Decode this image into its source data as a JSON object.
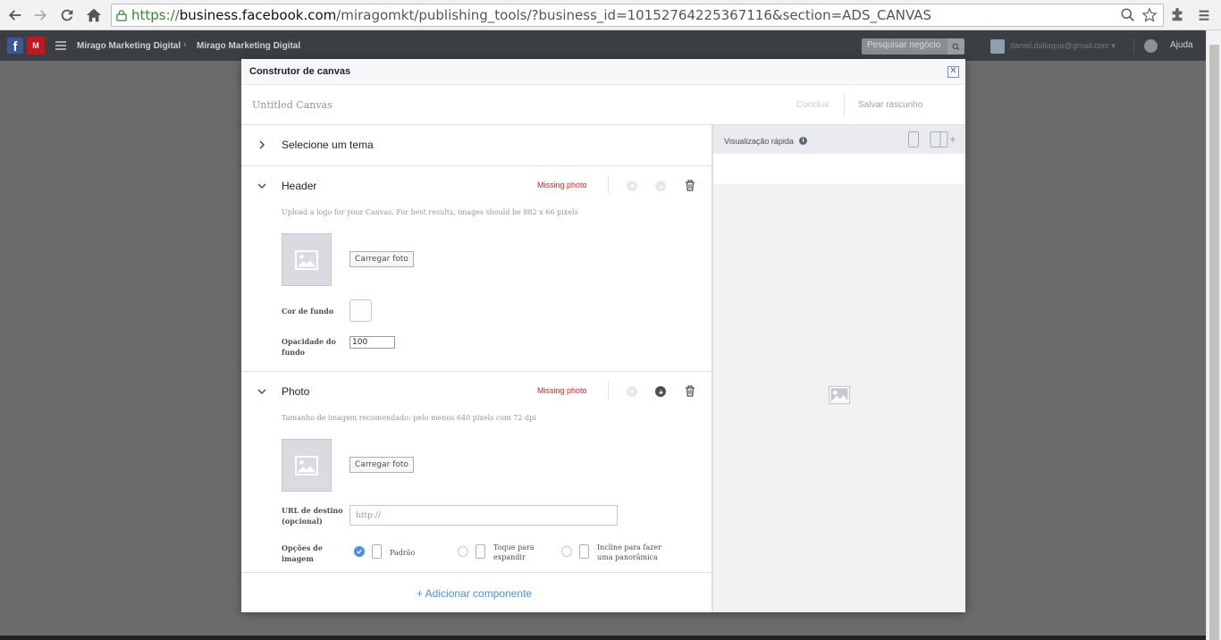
{
  "browser": {
    "url_scheme": "https://",
    "url_host": "business.facebook.com",
    "url_path": "/miragomkt/publishing_tools/?business_id=10152764225367116&section=ADS_CANVAS"
  },
  "fbbar": {
    "brand_logo_text": "M",
    "breadcrumb_1": "Mirago Marketing Digital",
    "breadcrumb_2": "Mirago Marketing Digital",
    "search_placeholder": "Pesquisar negócio",
    "user_email": "daniel.dallaqua@gmail.com ▾",
    "help_label": "Ajuda"
  },
  "modal": {
    "title": "Construtor de canvas",
    "canvas_name": "Untitled Canvas",
    "done_label": "Concluir",
    "save_draft_label": "Salvar rascunho"
  },
  "theme_section": {
    "label": "Selecione um tema"
  },
  "header_section": {
    "label": "Header",
    "status": "Missing photo",
    "hint": "Upload a logo for your Canvas. For best results, images should be 882 x 66 pixels",
    "upload_label": "Carregar foto",
    "bg_color_label": "Cor de fundo",
    "opacity_label_1": "Opacidade do",
    "opacity_label_2": "fundo",
    "opacity_value": "100"
  },
  "photo_section": {
    "label": "Photo",
    "status": "Missing photo",
    "hint": "Tamanho de imagem recomendado: pelo menos 640 pixels com 72 dpi",
    "upload_label": "Carregar foto",
    "url_label_1": "URL de destino",
    "url_label_2": "(opcional)",
    "url_placeholder": "http://",
    "options_label_1": "Opções de",
    "options_label_2": "imagem",
    "option_default": "Padrão",
    "option_tap_1": "Toque para",
    "option_tap_2": "expandir",
    "option_tilt_1": "Incline para fazer",
    "option_tilt_2": "uma panorâmica"
  },
  "add_component_label": "+ Adicionar componente",
  "preview": {
    "title": "Visualização rápida",
    "info_symbol": "i"
  },
  "colors": {
    "accent": "#4a90e2",
    "error": "#e02020",
    "fb_blue": "#3b5998"
  }
}
